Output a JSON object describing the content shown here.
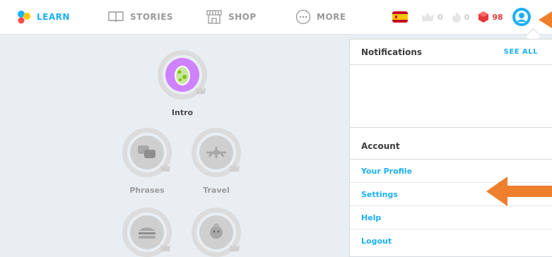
{
  "nav": {
    "learn": {
      "label": "LEARN",
      "icon": "duolingo-dots-icon"
    },
    "stories": {
      "label": "STORIES",
      "icon": "book-icon"
    },
    "shop": {
      "label": "SHOP",
      "icon": "shop-icon"
    },
    "more": {
      "label": "MORE",
      "icon": "more-dots-icon"
    }
  },
  "stats": {
    "language_flag": "spain-flag-icon",
    "crowns": "0",
    "streak": "0",
    "gems": "98"
  },
  "skills": [
    {
      "name": "Intro",
      "icon": "egg-icon",
      "state": "active"
    },
    {
      "name": "Phrases",
      "icon": "speech-bubbles-icon",
      "state": "locked"
    },
    {
      "name": "Travel",
      "icon": "airplane-icon",
      "state": "locked"
    },
    {
      "name": "",
      "icon": "burger-icon",
      "state": "locked"
    },
    {
      "name": "",
      "icon": "baby-icon",
      "state": "locked"
    }
  ],
  "dropdown": {
    "notifications_title": "Notifications",
    "see_all": "SEE ALL",
    "account_title": "Account",
    "items": [
      {
        "label": "Your Profile"
      },
      {
        "label": "Settings"
      },
      {
        "label": "Help"
      },
      {
        "label": "Logout"
      }
    ]
  },
  "colors": {
    "accent": "#1cb0f6",
    "arrow": "#ee7f2d",
    "egg_purple": "#ce82ff"
  }
}
